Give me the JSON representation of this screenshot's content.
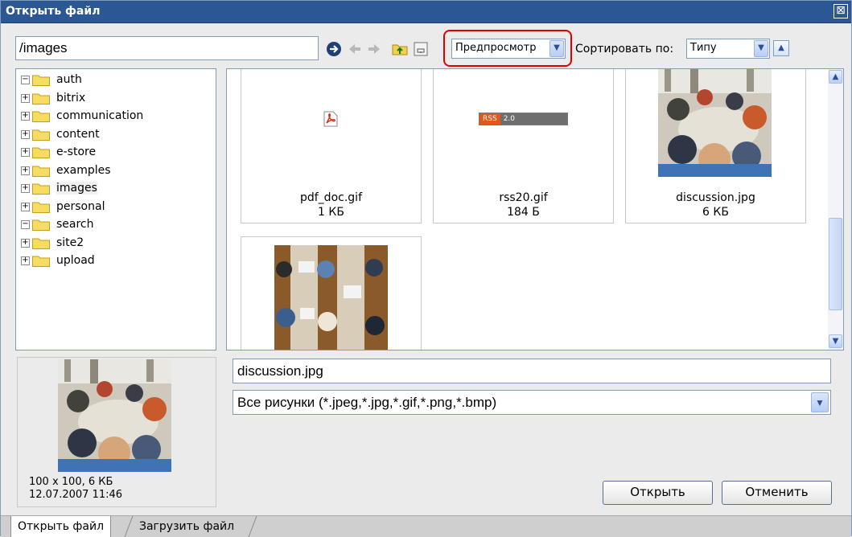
{
  "window": {
    "title": "Открыть файл",
    "close_glyph": "⊠"
  },
  "toolbar": {
    "path": "/images",
    "view_mode": "Предпросмотр",
    "sort_label": "Сортировать по:",
    "sort_value": "Типу",
    "icons": [
      "go-arrow-icon",
      "back-arrow-icon",
      "forward-arrow-icon",
      "folder-up-icon",
      "new-folder-icon"
    ]
  },
  "tree": {
    "items": [
      {
        "label": "auth",
        "expander": "−"
      },
      {
        "label": "bitrix",
        "expander": "+"
      },
      {
        "label": "communication",
        "expander": "+"
      },
      {
        "label": "content",
        "expander": "+"
      },
      {
        "label": "e-store",
        "expander": "+"
      },
      {
        "label": "examples",
        "expander": "+"
      },
      {
        "label": "images",
        "expander": "+",
        "selected": true
      },
      {
        "label": "personal",
        "expander": "+"
      },
      {
        "label": "search",
        "expander": "−"
      },
      {
        "label": "site2",
        "expander": "+"
      },
      {
        "label": "upload",
        "expander": "+"
      }
    ]
  },
  "files": [
    {
      "name": "pdf_doc.gif",
      "size": "1 КБ",
      "thumb": "pdf-icon"
    },
    {
      "name": "rss20.gif",
      "size": "184 Б",
      "thumb": "rss-badge",
      "badge_left": "RSS",
      "badge_right": "2.0"
    },
    {
      "name": "discussion.jpg",
      "size": "6 КБ",
      "thumb": "photo-discussion"
    },
    {
      "name": "",
      "size": "",
      "thumb": "photo-meeting"
    }
  ],
  "preview": {
    "dimensions": "100 x 100, 6 КБ",
    "date": "12.07.2007 11:46"
  },
  "form": {
    "filename": "discussion.jpg",
    "filter": "Все рисунки (*.jpeg,*.jpg,*.gif,*.png,*.bmp)",
    "open_label": "Открыть",
    "cancel_label": "Отменить"
  },
  "tabs": [
    {
      "label": "Открыть файл",
      "active": true
    },
    {
      "label": "Загрузить файл",
      "active": false
    }
  ],
  "colors": {
    "titlebar": "#2c5795",
    "highlight": "#e00000",
    "border": "#7f9db9"
  }
}
